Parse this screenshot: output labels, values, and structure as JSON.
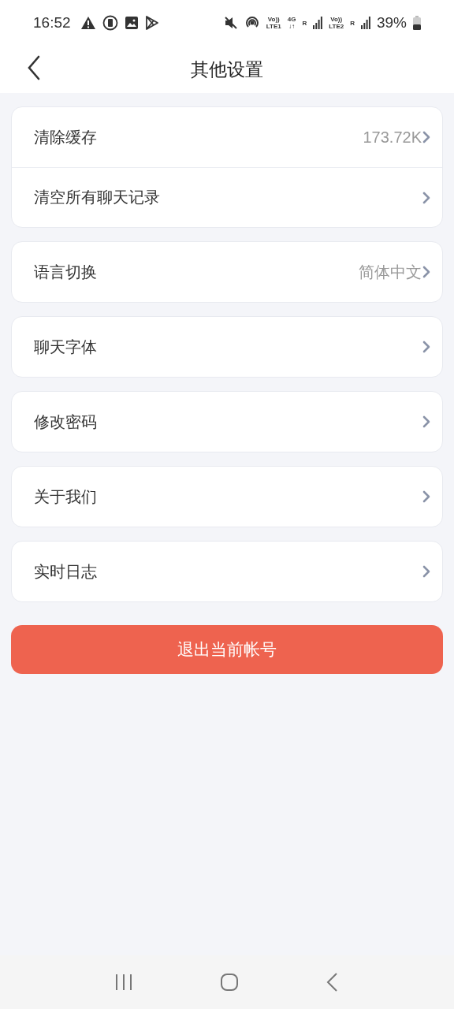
{
  "status_bar": {
    "time": "16:52",
    "network_labels": [
      {
        "top": "Vo))",
        "bottom": "LTE1"
      },
      {
        "top": "4G",
        "bottom": "↓↑"
      },
      {
        "top": "R"
      },
      {
        "top": "Vo))",
        "bottom": "LTE2"
      },
      {
        "top": "R"
      }
    ],
    "battery": "39%"
  },
  "header": {
    "title": "其他设置"
  },
  "groups": [
    {
      "items": [
        {
          "label": "清除缓存",
          "value": "173.72K"
        },
        {
          "label": "清空所有聊天记录"
        }
      ]
    },
    {
      "items": [
        {
          "label": "语言切换",
          "value": "简体中文"
        }
      ]
    },
    {
      "items": [
        {
          "label": "聊天字体"
        }
      ]
    },
    {
      "items": [
        {
          "label": "修改密码"
        }
      ]
    },
    {
      "items": [
        {
          "label": "关于我们"
        }
      ]
    },
    {
      "items": [
        {
          "label": "实时日志"
        }
      ]
    }
  ],
  "logout_button": "退出当前帐号"
}
